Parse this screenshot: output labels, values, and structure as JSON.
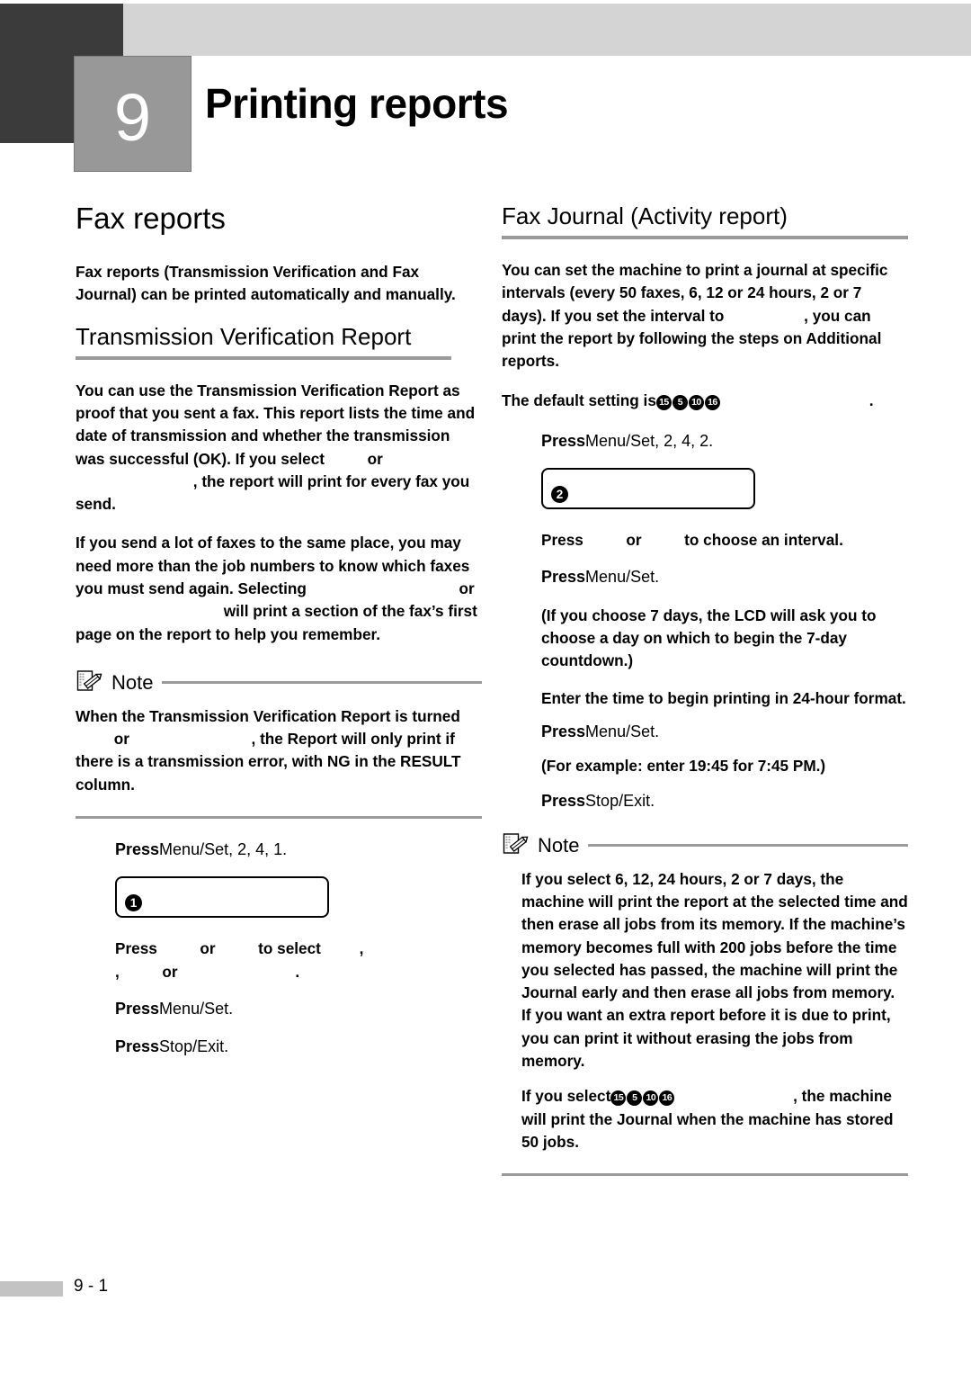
{
  "chapter": {
    "number": "9",
    "title": "Printing reports"
  },
  "left_column": {
    "heading": "Fax reports",
    "intro": "Fax reports (Transmission Verification and Fax Journal) can be printed automatically and manually.",
    "section": {
      "heading": "Transmission Verification Report",
      "para1_a": "You can use the Transmission Verification Report as proof that you sent a fax. This report lists the time and date of transmission and whether the transmission was successful (OK). If you select",
      "para1_b": "or",
      "para1_c": ", the report will print for every fax you send.",
      "para2_a": "If you send a lot of faxes to the same place, you may need more than the job numbers to know which faxes you must send again. Selecting",
      "para2_b": "or",
      "para2_c": "will print a section of the fax’s first page on the report to help you remember."
    },
    "note": {
      "label": "Note",
      "text_a": "When the Transmission Verification Report is turned",
      "text_b": "or",
      "text_c": ", the Report will only print if there is a transmission error, with NG in the RESULT column."
    },
    "steps": {
      "press_label": "Press",
      "menu_set_key": "Menu/Set",
      "menu_set_sequence": ", 2, 4, 1.",
      "menu_set_period": ".",
      "stop_exit_key": "Stop/Exit",
      "stop_exit_period": ".",
      "lcd_badge": "1",
      "select_a": "Press",
      "select_b": "or",
      "select_c": "to select",
      "select_d": ",",
      "select_e": ",",
      "select_f": "or",
      "select_g": "."
    }
  },
  "right_column": {
    "heading": "Fax Journal (Activity report)",
    "para1_a": "You can set the machine to print a journal at specific intervals (every 50 faxes, 6, 12 or 24 hours, 2 or 7 days). If you set the interval to",
    "para1_b": ", you can print the report by following the steps on Additional reports.",
    "default_setting_label": "The default setting is",
    "default_setting_circled": [
      "15",
      "5",
      "10",
      "16"
    ],
    "default_setting_period": ".",
    "steps": {
      "press_label": "Press",
      "menu_set_key": "Menu/Set",
      "menu_set_sequence": ", 2, 4, 2.",
      "menu_set_period": ".",
      "stop_exit_key": "Stop/Exit",
      "stop_exit_period": ".",
      "lcd_badge": "2",
      "interval_a": "Press",
      "interval_b": "or",
      "interval_c": "to choose an interval.",
      "seven_day": "(If you choose 7 days, the LCD will ask you to choose a day on which to begin the 7-day countdown.)",
      "enter_time": "Enter the time to begin printing in 24-hour format.",
      "example": "(For example: enter 19:45 for 7:45 PM.)"
    },
    "note": {
      "label": "Note",
      "text1": "If you select 6, 12, 24 hours, 2 or 7 days, the machine will print the report at the selected time and then erase all jobs from its memory. If the machine’s memory becomes full with 200 jobs before the time you selected has passed, the machine will print the Journal early and then erase all jobs from memory. If you want an extra report before it is due to print, you can print it without erasing the jobs from memory.",
      "text2_a": "If you select",
      "text2_circled": [
        "15",
        "5",
        "10",
        "16"
      ],
      "text2_b": ", the machine will print the Journal when the machine has stored 50 jobs."
    }
  },
  "footer": {
    "page": "9 - 1"
  },
  "colors": {
    "header_dark": "#3b3b3b",
    "header_light": "#d4d4d4",
    "number_box": "#989898",
    "rule_gray": "#9a9a9a",
    "footer_block": "#c3c3c3"
  }
}
